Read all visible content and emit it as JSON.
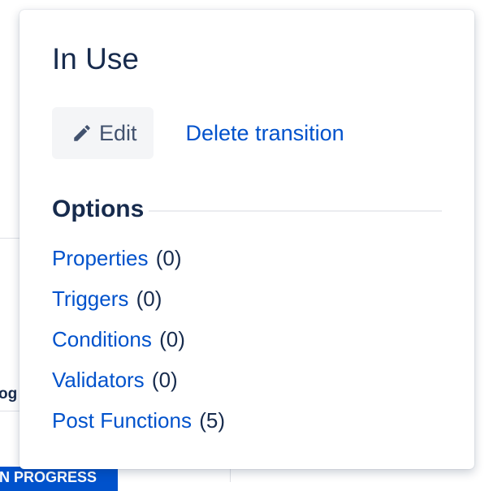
{
  "background": {
    "cut_label": "og",
    "status_lozenge": "IN PROGRESS"
  },
  "popover": {
    "title": "In Use",
    "edit_label": "Edit",
    "delete_label": "Delete transition",
    "options_heading": "Options",
    "options": [
      {
        "label": "Properties",
        "count": "(0)"
      },
      {
        "label": "Triggers",
        "count": "(0)"
      },
      {
        "label": "Conditions",
        "count": "(0)"
      },
      {
        "label": "Validators",
        "count": "(0)"
      },
      {
        "label": "Post Functions",
        "count": "(5)"
      }
    ]
  },
  "icons": {
    "edit": "pencil-icon"
  },
  "colors": {
    "link": "#0052cc",
    "text": "#172b4d",
    "button_bg": "#f4f5f7",
    "lozenge_bg": "#0052cc"
  }
}
